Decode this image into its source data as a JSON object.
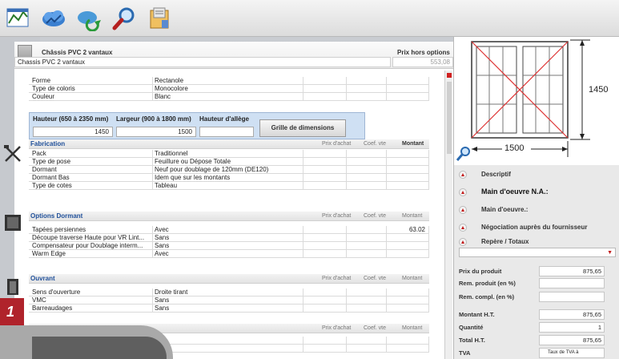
{
  "toolbar": {
    "icons": [
      "chart-icon",
      "cloud-arrows-icon",
      "refresh-arrow-icon",
      "magnifier-icon",
      "folder-note-icon"
    ]
  },
  "header": {
    "title": "Châssis PVC 2 vantaux",
    "field_value": "Chassis PVC 2 vantaux",
    "price_label": "Prix hors options",
    "price_value": "553,08"
  },
  "general_rows": [
    {
      "label": "Forme",
      "value": "Rectanole"
    },
    {
      "label": "Type de coloris",
      "value": "Monocolore"
    },
    {
      "label": "Couleur",
      "value": "Blanc"
    }
  ],
  "dimensions": {
    "height_label": "Hauteur (650 à 2350 mm)",
    "height_value": "1450",
    "width_label": "Largeur (900 à 1800 mm)",
    "width_value": "1500",
    "allege_label": "Hauteur d'allège",
    "allege_value": "",
    "grid_button": "Grille de dimensions"
  },
  "columns": {
    "purchase": "Prix d'achat",
    "coef": "Coef. vte",
    "amount": "Montant"
  },
  "sections": {
    "fabrication": {
      "title": "Fabrication",
      "rows": [
        {
          "label": "Pack",
          "value": "Traditionnel",
          "amount": ""
        },
        {
          "label": "Type de pose",
          "value": "Feuillure ou Dépose Totale",
          "amount": ""
        },
        {
          "label": "Dormant",
          "value": "Neuf pour doublage de 120mm (DE120)",
          "amount": ""
        },
        {
          "label": "Dormant Bas",
          "value": "Idem que sur les montants",
          "amount": ""
        },
        {
          "label": "Type de cotes",
          "value": "Tableau",
          "amount": ""
        }
      ]
    },
    "options_dormant": {
      "title": "Options Dormant",
      "rows": [
        {
          "label": "Tapées persiennes",
          "value": "Avec",
          "amount": "63.02"
        },
        {
          "label": "Découpe traverse Haute pour VR Lint...",
          "value": "Sans",
          "amount": ""
        },
        {
          "label": "Compensateur pour Doublage interm...",
          "value": "Sans",
          "amount": ""
        },
        {
          "label": "Warm Edge",
          "value": "Avec",
          "amount": ""
        }
      ]
    },
    "ouvrant": {
      "title": "Ouvrant",
      "rows": [
        {
          "label": "Sens d'ouverture",
          "value": "Droite tirant",
          "amount": ""
        },
        {
          "label": "VMC",
          "value": "Sans",
          "amount": ""
        },
        {
          "label": "Barreaudages",
          "value": "Sans",
          "amount": ""
        }
      ]
    },
    "quincaillerie": {
      "title": "",
      "rows": [
        {
          "label": "",
          "value": "ard",
          "amount": ""
        },
        {
          "label": "",
          "value": "e",
          "amount": ""
        }
      ]
    }
  },
  "drawing": {
    "height_dim": "1450",
    "width_dim": "1500"
  },
  "options": [
    {
      "label": "Descriptif"
    },
    {
      "label": "Main d'oeuvre N.A.:"
    },
    {
      "label": "Main d'oeuvre.:"
    },
    {
      "label": "Négociation auprès du fournisseur"
    },
    {
      "label": "Repère / Totaux"
    }
  ],
  "totals": [
    {
      "label": "Prix du produit",
      "value": "875,65"
    },
    {
      "label": "Rem. produit (en %)",
      "value": ""
    },
    {
      "label": "Rem. compl. (en %)",
      "value": ""
    },
    {
      "label": "Montant H.T.",
      "value": "875,65"
    },
    {
      "label": "Quantité",
      "value": "1"
    },
    {
      "label": "Total H.T.",
      "value": "875,65"
    },
    {
      "label": "TVA",
      "value": "Taux de TVA à"
    }
  ],
  "step_number": "1",
  "colors": {
    "accent": "#1f4f99",
    "red": "#c21a1a",
    "dims_bg": "#cfe0f3"
  }
}
